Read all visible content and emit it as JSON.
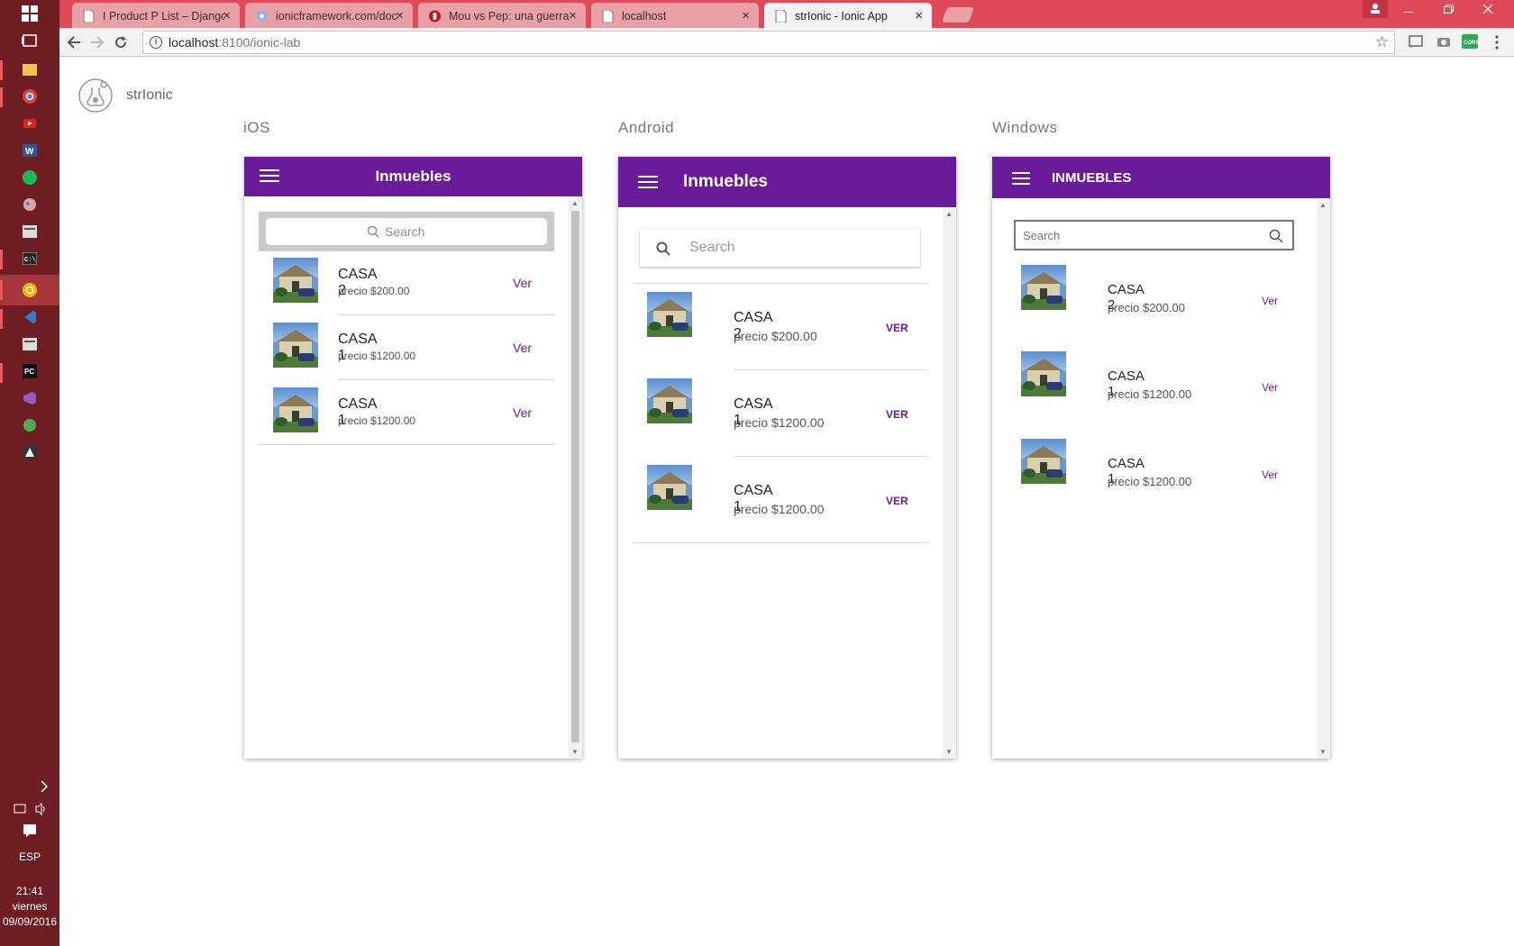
{
  "taskbar": {
    "lang": "ESP",
    "time": "21:41",
    "day": "viernes",
    "date": "09/09/2016"
  },
  "browser": {
    "tabs": [
      {
        "label": "I Product P List – Django"
      },
      {
        "label": "ionicframework.com/doc"
      },
      {
        "label": "Mou vs Pep: una guerra d"
      },
      {
        "label": "localhost"
      },
      {
        "label": "strIonic - Ionic App"
      }
    ],
    "url_host": "localhost",
    "url_path": ":8100/ionic-lab"
  },
  "lab": {
    "app_name": "strIonic",
    "platforms": {
      "ios": "iOS",
      "android": "Android",
      "windows": "Windows"
    }
  },
  "ios": {
    "title": "Inmuebles",
    "search_placeholder": "Search",
    "items": [
      {
        "title": "CASA 2",
        "price": "precio $200.00",
        "action": "Ver"
      },
      {
        "title": "CASA 1",
        "price": "precio $1200.00",
        "action": "Ver"
      },
      {
        "title": "CASA 1",
        "price": "precio $1200.00",
        "action": "Ver"
      }
    ]
  },
  "android": {
    "title": "Inmuebles",
    "search_placeholder": "Search",
    "items": [
      {
        "title": "CASA 2",
        "price": "precio $200.00",
        "action": "VER"
      },
      {
        "title": "CASA 1",
        "price": "precio $1200.00",
        "action": "VER"
      },
      {
        "title": "CASA 1",
        "price": "precio $1200.00",
        "action": "VER"
      }
    ]
  },
  "windows": {
    "title": "INMUEBLES",
    "search_placeholder": "Search",
    "items": [
      {
        "title": "CASA 2",
        "price": "precio $200.00",
        "action": "Ver"
      },
      {
        "title": "CASA 1",
        "price": "precio $1200.00",
        "action": "Ver"
      },
      {
        "title": "CASA 1",
        "price": "precio $1200.00",
        "action": "Ver"
      }
    ]
  },
  "colors": {
    "primary": "#6a1b9a",
    "chrome_frame": "#de4a58",
    "taskbar": "#6e1e22"
  }
}
